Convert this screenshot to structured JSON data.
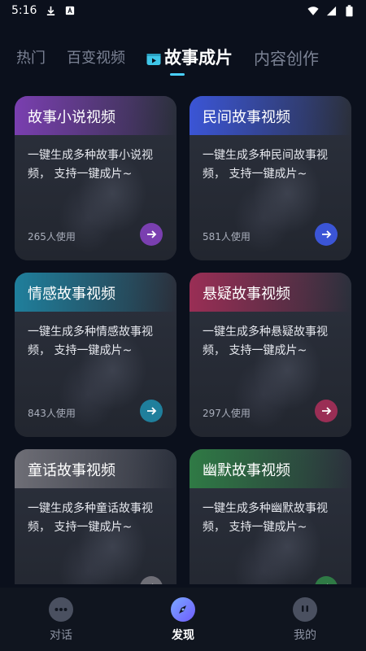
{
  "status_bar": {
    "time": "5:16",
    "icons": [
      "download-icon",
      "keyboard-a-icon",
      "wifi-icon",
      "signal-icon",
      "battery-icon"
    ]
  },
  "tabs": [
    {
      "label": "热门",
      "active": false
    },
    {
      "label": "百变视频",
      "active": false
    },
    {
      "label": "故事成片",
      "active": true,
      "icon": "video-icon"
    },
    {
      "label": "内容创作",
      "active": false
    }
  ],
  "cards": [
    {
      "title": "故事小说视频",
      "desc": "一键生成多种故事小说视频， 支持一键成片~",
      "uses": "265人使用",
      "accent": "#7a3fb0"
    },
    {
      "title": "民间故事视频",
      "desc": "一键生成多种民间故事视频， 支持一键成片~",
      "uses": "581人使用",
      "accent": "#3b55d6"
    },
    {
      "title": "情感故事视频",
      "desc": "一键生成多种情感故事视频， 支持一键成片~",
      "uses": "843人使用",
      "accent": "#1f7f9c"
    },
    {
      "title": "悬疑故事视频",
      "desc": "一键生成多种悬疑故事视频， 支持一键成片~",
      "uses": "297人使用",
      "accent": "#9a2e55"
    },
    {
      "title": "童话故事视频",
      "desc": "一键生成多种童话故事视频， 支持一键成片~",
      "uses": "",
      "accent": "#6e6e76"
    },
    {
      "title": "幽默故事视频",
      "desc": "一键生成多种幽默故事视频， 支持一键成片~",
      "uses": "",
      "accent": "#2f7a45"
    }
  ],
  "bottom_nav": [
    {
      "label": "对话",
      "icon": "chat-icon",
      "active": false
    },
    {
      "label": "发现",
      "icon": "compass-icon",
      "active": true
    },
    {
      "label": "我的",
      "icon": "profile-icon",
      "active": false
    }
  ]
}
